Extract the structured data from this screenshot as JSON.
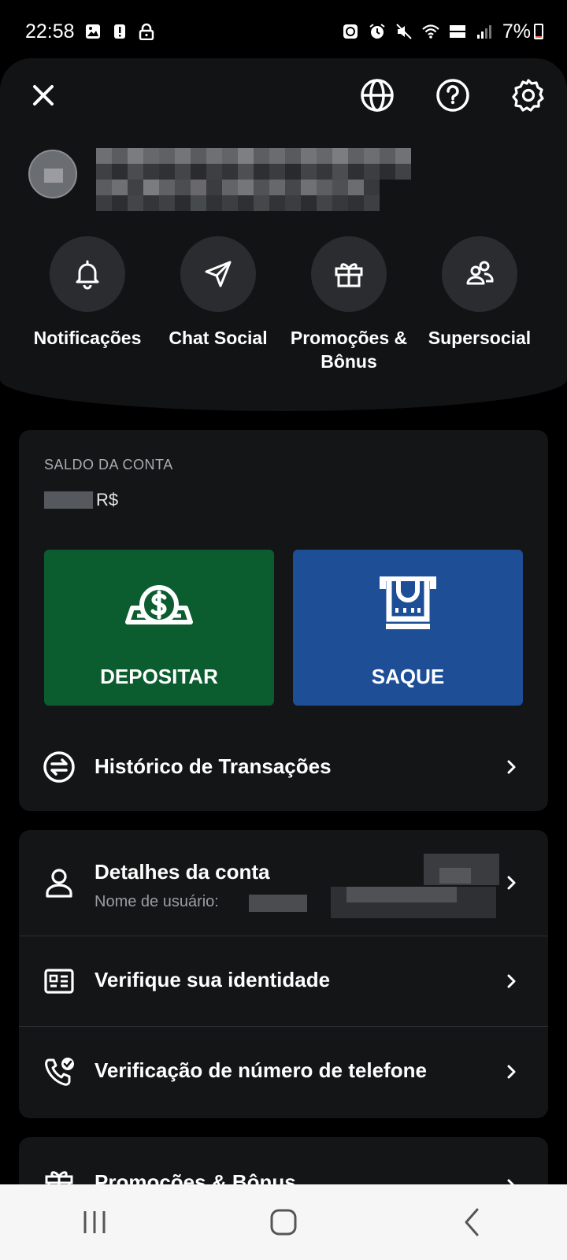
{
  "status_bar": {
    "time": "22:58",
    "battery": "7%",
    "icons_left": [
      "image-icon",
      "alert-icon",
      "lock-icon"
    ],
    "icons_right": [
      "recycle-icon",
      "alarm-icon",
      "mute-icon",
      "wifi-icon",
      "volte-icon",
      "signal-icon",
      "battery-icon"
    ]
  },
  "header": {
    "icons": [
      "close-icon",
      "globe-icon",
      "help-icon",
      "settings-icon"
    ]
  },
  "quick_actions": [
    {
      "label": "Notificações",
      "icon": "bell-icon"
    },
    {
      "label": "Chat Social",
      "icon": "send-icon"
    },
    {
      "label": "Promoções & Bônus",
      "icon": "gift-icon"
    },
    {
      "label": "Supersocial",
      "icon": "users-icon"
    }
  ],
  "balance": {
    "title": "SALDO DA CONTA",
    "currency": "R$",
    "deposit_label": "DEPOSITAR",
    "withdraw_label": "SAQUE",
    "history_label": "Histórico de Transações"
  },
  "account": {
    "details_label": "Detalhes da conta",
    "username_label": "Nome de usuário:",
    "verify_identity_label": "Verifique sua identidade",
    "verify_phone_label": "Verificação de número de telefone"
  },
  "promotions": {
    "label": "Promoções & Bônus"
  },
  "colors": {
    "deposit": "#0b5c2f",
    "withdraw": "#1d4e96",
    "panel": "#121314",
    "card": "#141516"
  }
}
